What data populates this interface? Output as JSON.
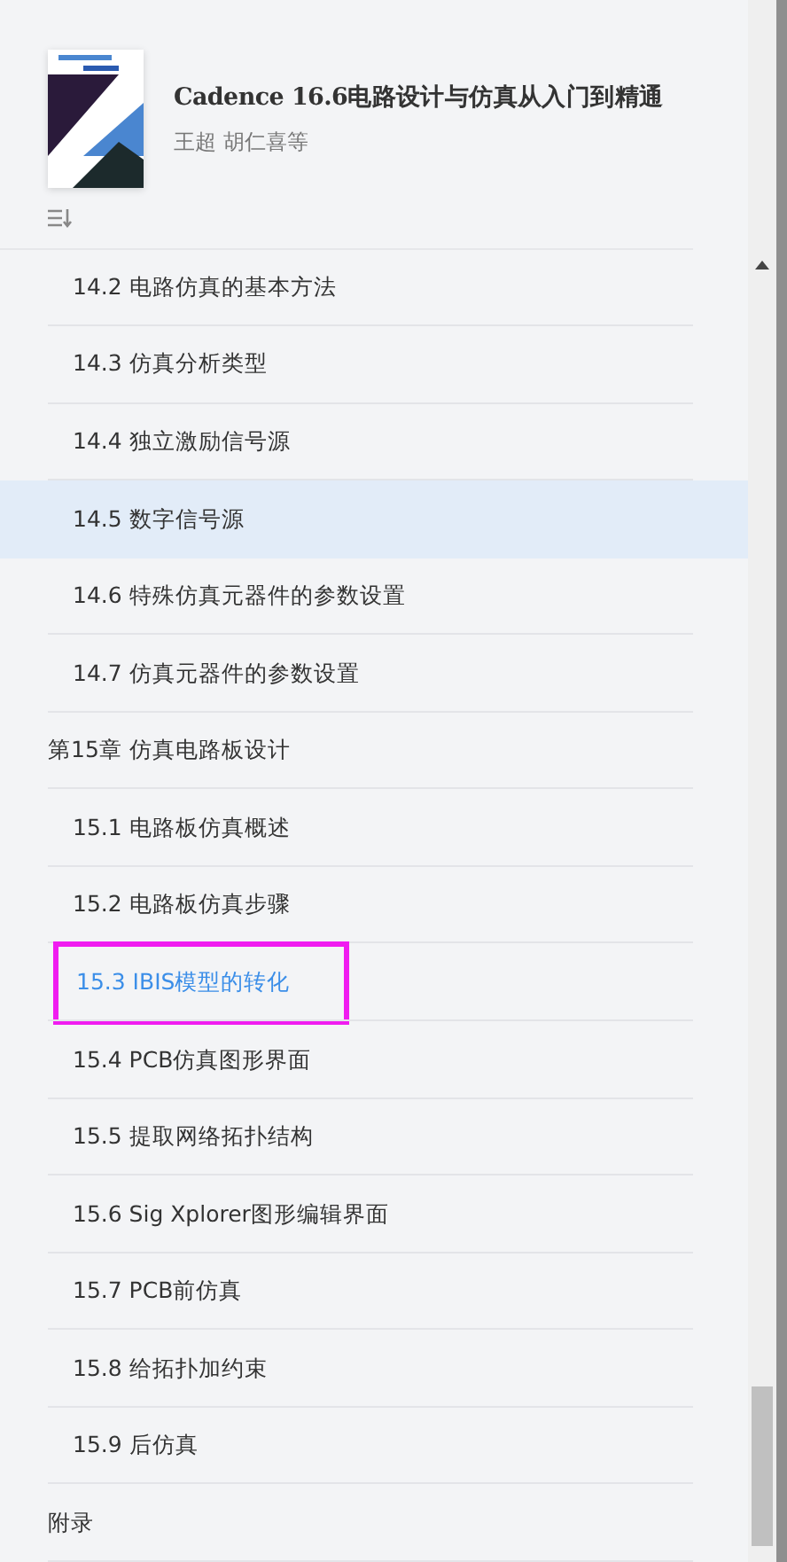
{
  "book": {
    "title": "Cadence 16.6电路设计与仿真从入门到精通",
    "authors": "王超 胡仁喜等"
  },
  "toc": [
    {
      "children": [
        {
          "label": "14.2 电路仿真的基本方法",
          "selected": false,
          "highlighted": false,
          "outlined": false
        },
        {
          "label": "14.3 仿真分析类型",
          "selected": false,
          "highlighted": false,
          "outlined": false
        },
        {
          "label": "14.4 独立激励信号源",
          "selected": false,
          "highlighted": false,
          "outlined": false
        },
        {
          "label": "14.5 数字信号源",
          "selected": false,
          "highlighted": true,
          "outlined": false
        },
        {
          "label": "14.6 特殊仿真元器件的参数设置",
          "selected": false,
          "highlighted": false,
          "outlined": false
        },
        {
          "label": "14.7 仿真元器件的参数设置",
          "selected": false,
          "highlighted": false,
          "outlined": false
        }
      ]
    },
    {
      "label": "第15章 仿真电路板设计",
      "selected": false,
      "highlighted": false,
      "outlined": false,
      "children": [
        {
          "label": "15.1 电路板仿真概述",
          "selected": false,
          "highlighted": false,
          "outlined": false
        },
        {
          "label": "15.2 电路板仿真步骤",
          "selected": false,
          "highlighted": false,
          "outlined": false
        },
        {
          "label": "15.3 IBIS模型的转化",
          "selected": true,
          "highlighted": false,
          "outlined": true
        },
        {
          "label": "15.4 PCB仿真图形界面",
          "selected": false,
          "highlighted": false,
          "outlined": false
        },
        {
          "label": "15.5 提取网络拓扑结构",
          "selected": false,
          "highlighted": false,
          "outlined": false
        },
        {
          "label": "15.6 Sig Xplorer图形编辑界面",
          "selected": false,
          "highlighted": false,
          "outlined": false
        },
        {
          "label": "15.7 PCB前仿真",
          "selected": false,
          "highlighted": false,
          "outlined": false
        },
        {
          "label": "15.8 给拓扑加约束",
          "selected": false,
          "highlighted": false,
          "outlined": false
        },
        {
          "label": "15.9 后仿真",
          "selected": false,
          "highlighted": false,
          "outlined": false
        }
      ]
    },
    {
      "label": "附录",
      "selected": false,
      "highlighted": false,
      "outlined": false
    }
  ]
}
